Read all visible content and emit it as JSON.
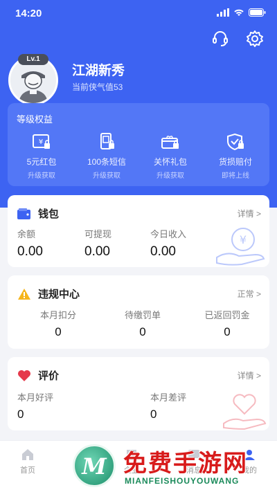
{
  "status": {
    "time": "14:20"
  },
  "profile": {
    "level": "Lv.1",
    "name": "江湖新秀",
    "subtitle": "当前侠气值53"
  },
  "perks": {
    "title": "等级权益",
    "items": [
      {
        "label": "5元红包",
        "sub": "升级获取",
        "icon": "red-packet-icon"
      },
      {
        "label": "100条短信",
        "sub": "升级获取",
        "icon": "sms-icon"
      },
      {
        "label": "关怀礼包",
        "sub": "升级获取",
        "icon": "gift-icon"
      },
      {
        "label": "货损赔付",
        "sub": "即将上线",
        "icon": "shield-check-icon"
      }
    ]
  },
  "wallet": {
    "title": "钱包",
    "link": "详情 >",
    "stats": [
      {
        "label": "余额",
        "value": "0.00"
      },
      {
        "label": "可提现",
        "value": "0.00"
      },
      {
        "label": "今日收入",
        "value": "0.00"
      }
    ]
  },
  "violation": {
    "title": "违规中心",
    "link": "正常 >",
    "stats": [
      {
        "label": "本月扣分",
        "value": "0"
      },
      {
        "label": "待缴罚单",
        "value": "0"
      },
      {
        "label": "已返回罚金",
        "value": "0"
      }
    ]
  },
  "review": {
    "title": "评价",
    "link": "详情 >",
    "stats": [
      {
        "label": "本月好评",
        "value": "0"
      },
      {
        "label": "本月差评",
        "value": "0"
      }
    ]
  },
  "tabbar": {
    "items": [
      {
        "label": "首页"
      },
      {
        "label": "企业"
      },
      {
        "label": "消息"
      },
      {
        "label": "我的"
      }
    ]
  },
  "promo": {
    "logo_letter": "M",
    "title": "免费手游网",
    "subtitle": "MIANFEISHOUYOUWANG"
  },
  "colors": {
    "primary": "#3d63f2",
    "perk_panel": "#5377f6",
    "wallet_icon": "#3d63f2",
    "warning": "#f5b51c",
    "heart": "#e5394b"
  }
}
